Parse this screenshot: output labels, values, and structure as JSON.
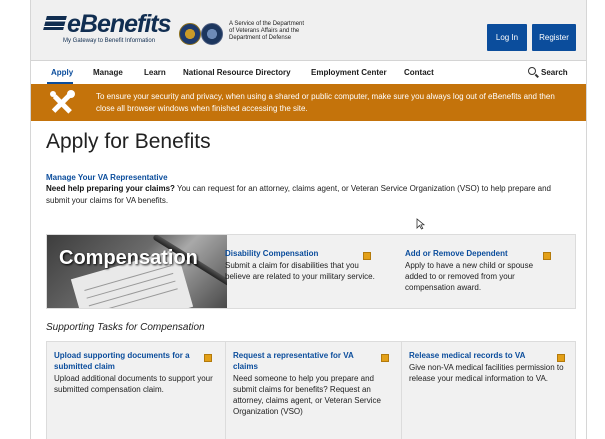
{
  "header": {
    "logo_text": "eBenefits",
    "logo_tagline": "My Gateway to Benefit Information",
    "service_line1": "A Service of the Department",
    "service_line2": "of Veterans Affairs and the",
    "service_line3": "Department of Defense",
    "login_label": "Log In",
    "register_label": "Register"
  },
  "nav": {
    "items": [
      "Apply",
      "Manage",
      "Learn",
      "National Resource Directory",
      "Employment Center",
      "Contact"
    ],
    "search_label": "Search",
    "active": "Apply"
  },
  "banner": {
    "text": "To ensure your security and privacy, when using a shared or public computer, make sure you always log out of eBenefits and then close all browser windows when finished accessing the site."
  },
  "main": {
    "title": "Apply for Benefits",
    "manage_link": "Manage Your VA Representative",
    "help_bold": "Need help preparing your claims?",
    "help_text": " You can request for an attorney, claims agent, or Veteran Service Organization (VSO) to help prepare and submit your claims for VA benefits.",
    "image_label": "Compensation",
    "cards": [
      {
        "title": "Disability Compensation",
        "desc": "Submit a claim for disabilities that you believe are related to your military service."
      },
      {
        "title": "Add or Remove Dependent",
        "desc": "Apply to have a new child or spouse added to or removed from your compensation award."
      }
    ],
    "supporting_title": "Supporting Tasks for Compensation",
    "supporting": [
      {
        "title": "Upload supporting documents for a submitted claim",
        "desc": "Upload additional documents to support your submitted compensation claim."
      },
      {
        "title": "Request a representative for VA claims",
        "desc": "Need someone to help you prepare and submit claims for benefits? Request an attorney, claims agent, or Veteran Service Organization (VSO)"
      },
      {
        "title": "Release medical records to VA",
        "desc": "Give non-VA medical facilities permission to release your medical information to VA."
      }
    ]
  },
  "colors": {
    "brand_blue": "#0b4d9c",
    "navy": "#112e51",
    "banner_orange": "#c4730b"
  }
}
